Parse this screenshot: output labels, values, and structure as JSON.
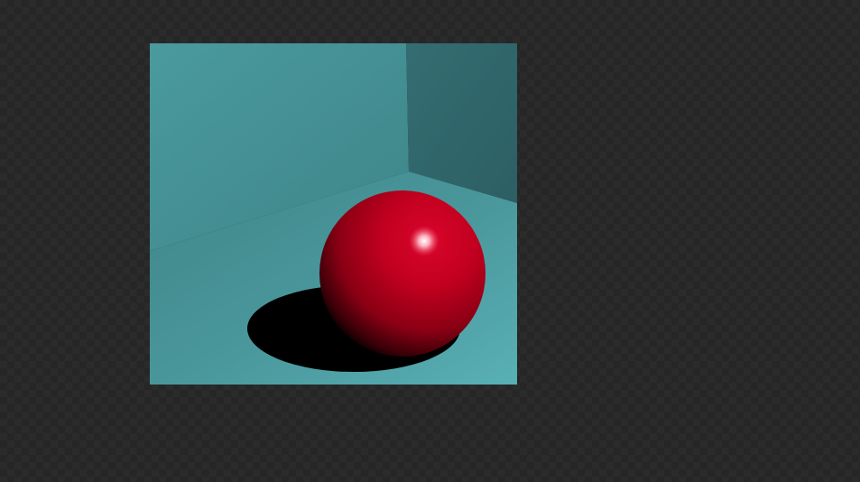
{
  "viewer": {
    "background": "checkerboard-dark",
    "image": {
      "subject": "render",
      "colors": {
        "back_wall": "#458f93",
        "right_wall": "#2f6468",
        "floor": "#4da1a6",
        "sphere": "#c4001f",
        "sphere_shadow": "#000000",
        "specular": "#ffffff"
      }
    }
  }
}
